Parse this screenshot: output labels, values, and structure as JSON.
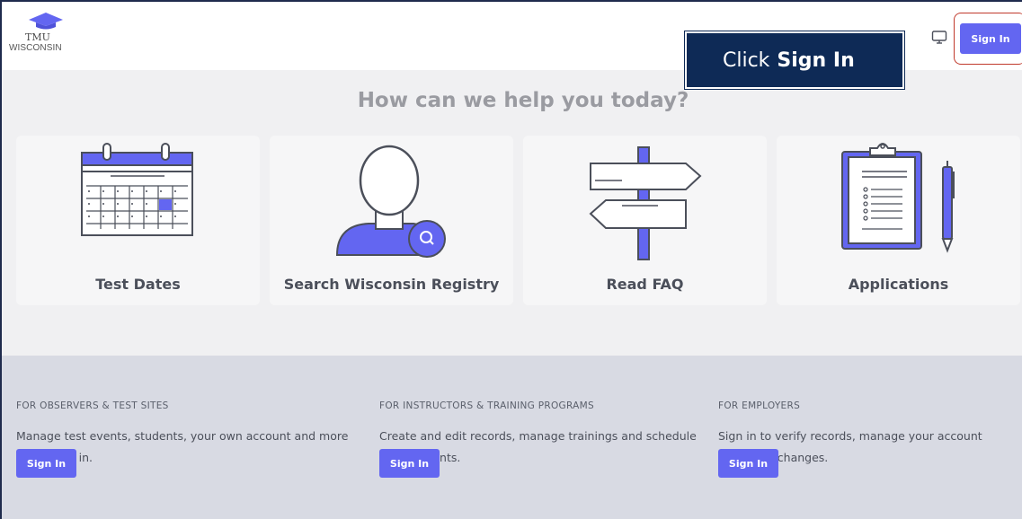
{
  "header": {
    "logo_title": "TMU",
    "logo_subtitle": "WISCONSIN",
    "signin_label": "Sign In",
    "monitor_icon": "monitor-icon"
  },
  "callout": {
    "prefix": "Click",
    "bold": "Sign In"
  },
  "help": {
    "title": "How can we help you today?",
    "cards": [
      {
        "label": "Test Dates",
        "icon": "calendar-icon"
      },
      {
        "label": "Search Wisconsin Registry",
        "icon": "person-search-icon"
      },
      {
        "label": "Read FAQ",
        "icon": "signpost-icon"
      },
      {
        "label": "Applications",
        "icon": "clipboard-icon"
      }
    ]
  },
  "audiences": [
    {
      "heading": "FOR OBSERVERS & TEST SITES",
      "description": "Manage test events, students, your own account and more by logging in.",
      "button": "Sign In"
    },
    {
      "heading": "FOR INSTRUCTORS & TRAINING PROGRAMS",
      "description": "Create and edit records, manage trainings and schedule your students.",
      "button": "Sign In"
    },
    {
      "heading": "FOR EMPLOYERS",
      "description": "Sign in to verify records, manage your account and make changes.",
      "button": "Sign In"
    }
  ],
  "colors": {
    "accent": "#6366f1",
    "callout_bg": "#0e2a56",
    "highlight": "#c0392b"
  }
}
